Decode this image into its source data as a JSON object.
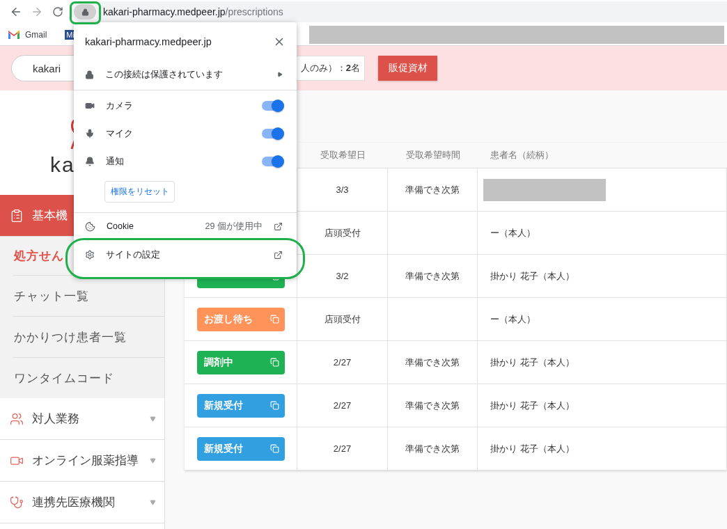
{
  "browser": {
    "url_host": "kakari-pharmacy.medpeer.jp",
    "url_path": "/prescriptions",
    "bookmarks": [
      {
        "kind": "gmail",
        "label": "Gmail"
      },
      {
        "kind": "tile",
        "label": "Mi"
      }
    ]
  },
  "banner": {
    "search_value": "kakari",
    "count_text": "人のみ）：**2**名",
    "button": "販促資材"
  },
  "sidebar": {
    "logo_text": "ka",
    "items": [
      {
        "label": "基本機",
        "selected": true,
        "expanded": true,
        "children": [
          {
            "label": "処方せん",
            "selected": true
          },
          {
            "label": "チャット一覧",
            "selected": false
          },
          {
            "label": "かかりつけ患者一覧",
            "selected": false
          },
          {
            "label": "ワンタイムコード",
            "selected": false
          }
        ]
      },
      {
        "label": "対人業務",
        "selected": false,
        "expanded": false
      },
      {
        "label": "オンライン服薬指導",
        "selected": false,
        "expanded": false
      },
      {
        "label": "連携先医療機関",
        "selected": false,
        "expanded": false
      }
    ]
  },
  "table": {
    "columns": [
      "受取希望日",
      "受取希望時間",
      "患者名（続柄）"
    ],
    "rows": [
      {
        "date": "3/3",
        "time": "準備でき次第",
        "redacted": true
      },
      {
        "date": "店頭受付",
        "patient": "ー（本人）"
      },
      {
        "status": {
          "color": "#1fb254"
        },
        "date": "3/2",
        "time": "準備でき次第",
        "patient": "掛かり 花子（本人）"
      },
      {
        "status": {
          "label": "お渡し待ち",
          "color": "#ff935a"
        },
        "date": "店頭受付",
        "patient": "ー（本人）"
      },
      {
        "status": {
          "label": "調剤中",
          "color": "#1fb254"
        },
        "date": "2/27",
        "time": "準備でき次第",
        "patient": "掛かり 花子（本人）"
      },
      {
        "status": {
          "label": "新規受付",
          "color": "#319fe0"
        },
        "date": "2/27",
        "time": "準備でき次第",
        "patient": "掛かり 花子（本人）"
      },
      {
        "status": {
          "label": "新規受付",
          "color": "#319fe0"
        },
        "date": "2/27",
        "time": "準備でき次第",
        "patient": "掛かり 花子（本人）"
      }
    ]
  },
  "popup": {
    "title": "kakari-pharmacy.medpeer.jp",
    "connection": "この接続は保護されています",
    "permissions": [
      {
        "label": "カメラ",
        "on": true
      },
      {
        "label": "マイク",
        "on": true
      },
      {
        "label": "通知",
        "on": true
      }
    ],
    "reset_button": "権限をリセット",
    "cookie": {
      "label": "Cookie",
      "count": "29 個が使用中"
    },
    "site_settings": "サイトの設定"
  }
}
